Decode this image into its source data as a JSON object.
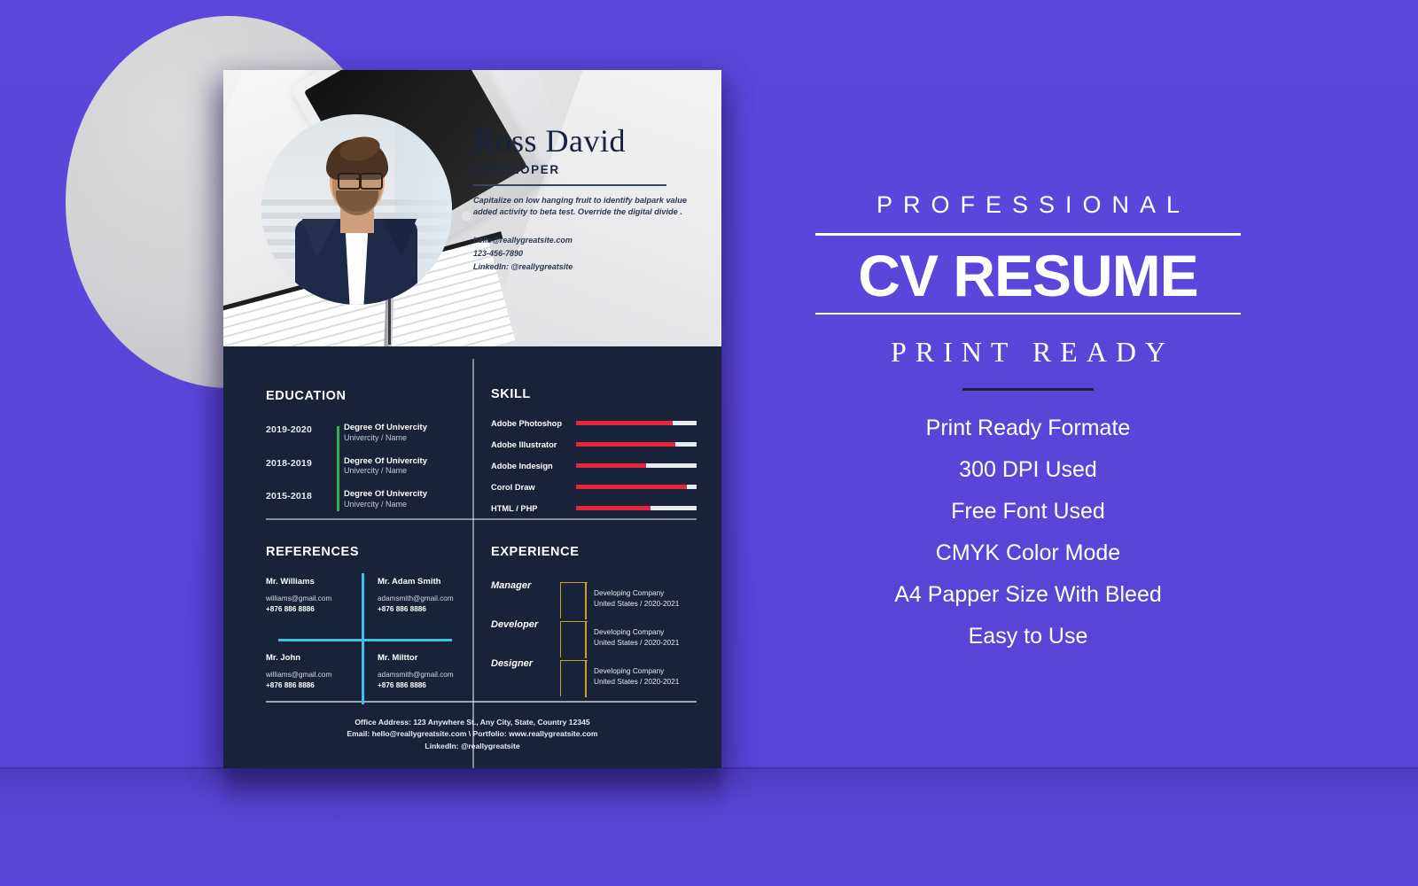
{
  "backdrop": {
    "wall_color": "#5a45d9",
    "floor_color": "#5743cf",
    "circle_color": "#d3d3d5"
  },
  "resume": {
    "header": {
      "name": "Ross David",
      "role": "DEVELOPER",
      "about": "Capitalize on low hanging fruit to identify balpark value added activity to beta test. Override the digital divide .",
      "email": "hello@reallygreatsite.com",
      "phone": "123-456-7890",
      "linkedin": "LinkedIn: @reallygreatsite"
    },
    "education": {
      "title": "EDUCATION",
      "accent": "#32b34a",
      "items": [
        {
          "year": "2019-2020",
          "degree": "Degree Of Univercity",
          "school": "Univercity / Name"
        },
        {
          "year": "2018-2019",
          "degree": "Degree Of Univercity",
          "school": "Univercity / Name"
        },
        {
          "year": "2015-2018",
          "degree": "Degree Of Univercity",
          "school": "Univercity / Name"
        }
      ]
    },
    "skill": {
      "title": "SKILL",
      "fill_color": "#e8243c",
      "track_color": "#e6ecf2",
      "items": [
        {
          "label": "Adobe Photoshop",
          "percent": 80
        },
        {
          "label": "Adobe Illustrator",
          "percent": 82
        },
        {
          "label": "Adobe Indesign",
          "percent": 58
        },
        {
          "label": "Corol Draw",
          "percent": 92
        },
        {
          "label": "HTML / PHP",
          "percent": 62
        }
      ]
    },
    "references": {
      "title": "REFERENCES",
      "accent": "#3fc3e0",
      "items": [
        {
          "name": "Mr. Williams",
          "email": "williams@gmail.com",
          "phone": "+876 886 8886"
        },
        {
          "name": "Mr. Adam Smith",
          "email": "adamsmith@gmail.com",
          "phone": "+876 886 8886"
        },
        {
          "name": "Mr. John",
          "email": "williams@gmail.com",
          "phone": "+876 886 8886"
        },
        {
          "name": "Mr. Milttor",
          "email": "adamsmith@gmail.com",
          "phone": "+876 886 8886"
        }
      ]
    },
    "experience": {
      "title": "EXPERIENCE",
      "accent": "#c9a227",
      "items": [
        {
          "role": "Manager",
          "company": "Developing Company",
          "place": "United States / 2020-2021"
        },
        {
          "role": "Developer",
          "company": "Developing Company",
          "place": "United States / 2020-2021"
        },
        {
          "role": "Designer",
          "company": "Developing Company",
          "place": "United States / 2020-2021"
        }
      ]
    },
    "footer": {
      "line1": "Office Address: 123 Anywhere St., Any City, State, Country 12345",
      "line2": "Email: hello@reallygreatsite.com \\ Portfolio: www.reallygreatsite.com",
      "line3": "LinkedIn: @reallygreatsite"
    }
  },
  "right_panel": {
    "eyebrow": "PROFESSIONAL",
    "title": "CV RESUME",
    "subtitle": "PRINT READY",
    "features": [
      "Print Ready Formate",
      "300 DPI Used",
      "Free Font Used",
      "CMYK Color Mode",
      "A4 Papper Size With Bleed",
      "Easy to Use"
    ]
  }
}
